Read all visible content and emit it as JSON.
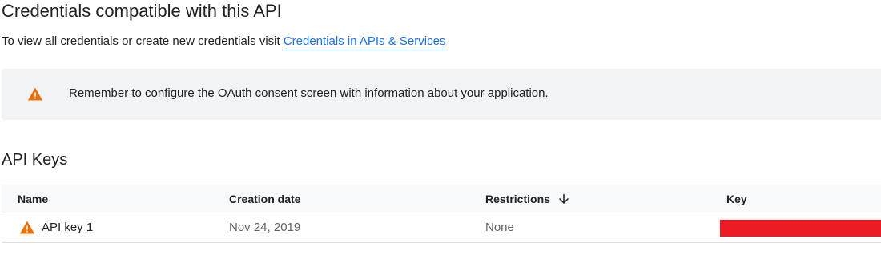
{
  "page": {
    "title": "Credentials compatible with this API",
    "intro_text": "To view all credentials or create new credentials visit ",
    "intro_link": "Credentials in APIs & Services"
  },
  "banner": {
    "icon": "warning-icon",
    "message": "Remember to configure the OAuth consent screen with information about your application."
  },
  "api_keys": {
    "section_title": "API Keys",
    "columns": {
      "name": "Name",
      "creation_date": "Creation date",
      "restrictions": "Restrictions",
      "key": "Key"
    },
    "sort_icon": "arrow-down-icon",
    "rows": [
      {
        "name": "API key 1",
        "creation_date": "Nov 24, 2019",
        "restrictions": "None",
        "key_redacted_color": "#ed1c24",
        "status_icon": "warning-icon"
      }
    ]
  },
  "colors": {
    "link": "#1a73e8",
    "warning": "#e8710a",
    "banner_bg": "#f1f3f4",
    "header_bg": "#f8f9fa",
    "redaction": "#ed1c24"
  }
}
